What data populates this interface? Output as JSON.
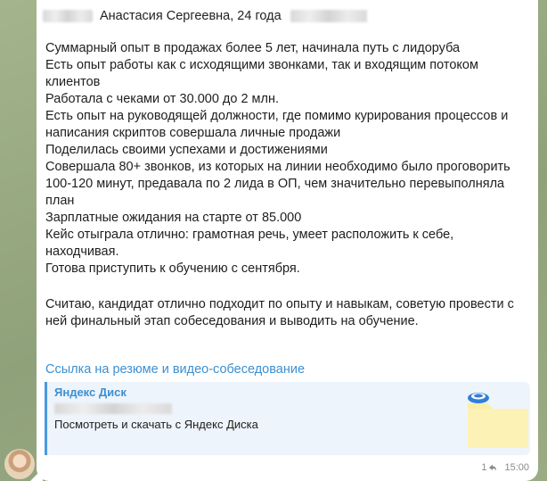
{
  "message": {
    "header": {
      "title": "Анастасия Сергеевна, 24 года"
    },
    "lines": [
      "Суммарный опыт в продажах более 5 лет, начинала путь с лидоруба",
      "Есть опыт работы как с исходящими звонками, так и входящим потоком",
      "клиентов",
      "Работала с чеками от 30.000 до 2 млн.",
      "Есть опыт на руководящей должности, где помимо курирования процессов и",
      "написания скриптов совершала личные продажи",
      "Поделилась своими успехами и достижениями",
      "Совершала 80+ звонков, из которых на линии необходимо было проговорить",
      "100-120 минут, предавала по 2 лида в ОП, чем значительно перевыполняла",
      "план",
      "Зарплатные ожидания на старте от 85.000",
      "Кейс отыграла отлично: грамотная речь, умеет расположить к себе,",
      "находчивая.",
      "Готова приступить к обучению с сентября."
    ],
    "conclusion_lines": [
      "Считаю, кандидат отлично подходит по опыту и  навыкам, советую провести с",
      "ней финальный этап собеседования и выводить на обучение."
    ],
    "link_text": "Ссылка на резюме и видео-собеседование",
    "preview": {
      "site_name": "Яндекс Диск",
      "description": "Посмотреть и скачать с Яндекс Диска",
      "icon": "yandex-disk-folder-icon"
    },
    "footer": {
      "views": "1",
      "time": "15:00",
      "views_icon": "reply-count-icon"
    }
  },
  "colors": {
    "link": "#3b8fd1",
    "preview_bg": "#eef4fb",
    "preview_bar": "#4a9ae0",
    "wallpaper": "#98a982"
  }
}
